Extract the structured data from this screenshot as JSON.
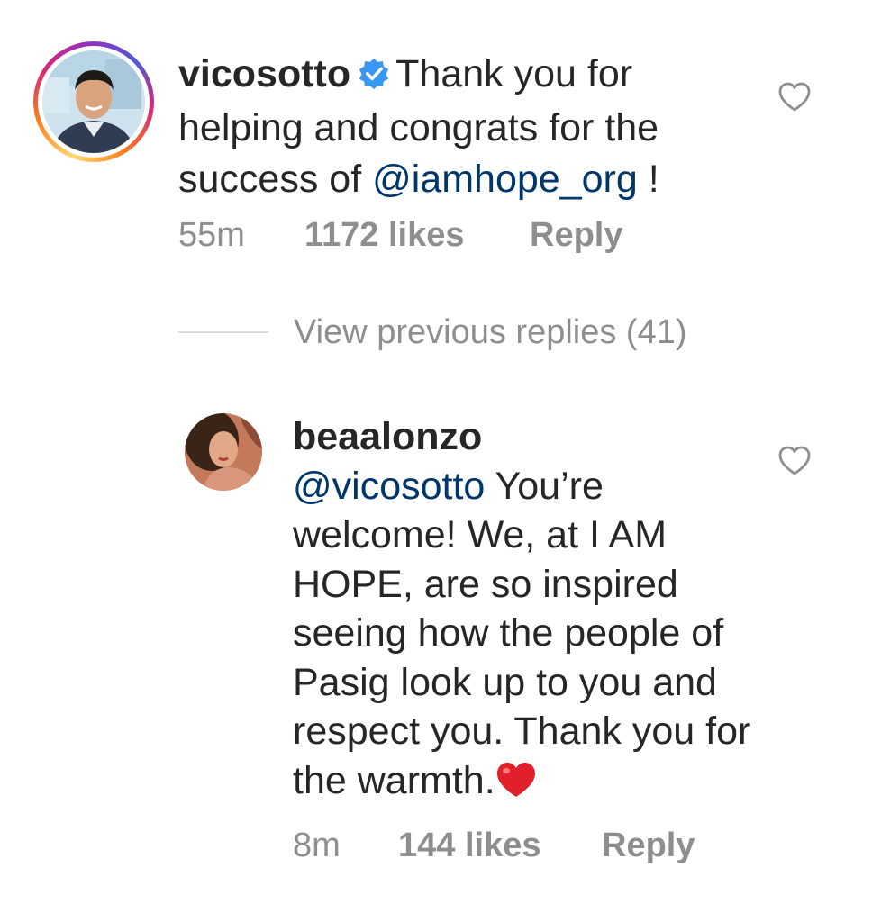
{
  "comment1": {
    "username": "vicosotto",
    "verified_icon": "verified-badge-icon",
    "text_before": "Thank you for helping and congrats for the success of ",
    "mention": "@iamhope_org",
    "text_after": " !",
    "time": "55m",
    "likes": "1172 likes",
    "reply": "Reply"
  },
  "view_previous": "View previous replies (41)",
  "comment2": {
    "username": "beaalonzo",
    "mention": "@vicosotto",
    "text": " You’re welcome! We, at I AM HOPE, are so inspired seeing how the people of Pasig look up to you and respect you. Thank you for the warmth.",
    "emoji": "❤️",
    "time": "8m",
    "likes": "144 likes",
    "reply": "Reply"
  },
  "colors": {
    "text": "#262626",
    "muted": "#8e8e8e",
    "link": "#00376b",
    "verified": "#3897f0"
  }
}
